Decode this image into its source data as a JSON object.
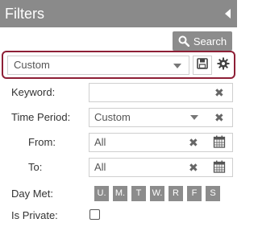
{
  "header": {
    "title": "Filters",
    "collapse_icon": "chevron-left-icon"
  },
  "search_button": {
    "label": "Search",
    "icon": "search-icon"
  },
  "preset": {
    "selected": "Custom",
    "save_icon": "save-icon",
    "settings_icon": "gear-icon",
    "highlight_color": "#8e1f36"
  },
  "keyword": {
    "label": "Keyword:",
    "value": ""
  },
  "time_period": {
    "label": "Time Period:",
    "selected": "Custom"
  },
  "from": {
    "label": "From:",
    "value": "All"
  },
  "to": {
    "label": "To:",
    "value": "All"
  },
  "day_met": {
    "label": "Day Met:",
    "days": [
      "U.",
      "M.",
      "T",
      "W.",
      "R",
      "F",
      "S"
    ]
  },
  "is_private": {
    "label": "Is Private:",
    "checked": false
  },
  "colors": {
    "header_bg": "#8a8a8a",
    "button_bg": "#8c8c8c"
  }
}
